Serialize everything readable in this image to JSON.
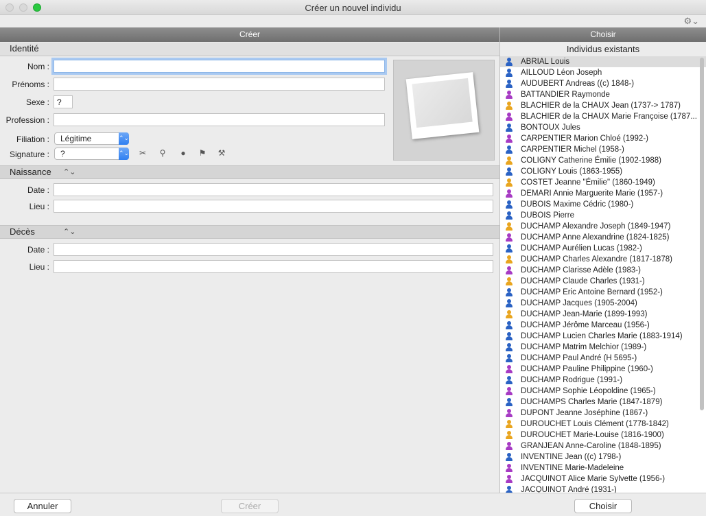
{
  "window": {
    "title": "Créer un nouvel individu"
  },
  "icons": {
    "settings": "gear-icon"
  },
  "headers": {
    "left": "Créer",
    "right": "Choisir"
  },
  "identity": {
    "title": "Identité",
    "nom_label": "Nom :",
    "nom_value": "",
    "prenoms_label": "Prénoms :",
    "prenoms_value": "",
    "sexe_label": "Sexe :",
    "sexe_value": "?",
    "profession_label": "Profession :",
    "profession_value": "",
    "filiation_label": "Filiation :",
    "filiation_value": "Légitime",
    "signature_label": "Signature :",
    "signature_value": "?",
    "signature_icons": [
      "scissors-icon",
      "search-cross-icon",
      "person-icon",
      "flag-icon",
      "gavel-icon"
    ]
  },
  "naissance": {
    "title": "Naissance",
    "date_label": "Date :",
    "date_value": "",
    "lieu_label": "Lieu :",
    "lieu_value": ""
  },
  "deces": {
    "title": "Décès",
    "date_label": "Date :",
    "date_value": "",
    "lieu_label": "Lieu :",
    "lieu_value": ""
  },
  "list": {
    "title": "Individus existants",
    "colors": {
      "male": "#2a62c4",
      "female": "#a73bc4",
      "unknown": "#e9a51f"
    },
    "items": [
      {
        "name": "ABRIAL Louis",
        "sex": "male",
        "selected": true
      },
      {
        "name": "AILLOUD Léon Joseph",
        "sex": "male"
      },
      {
        "name": "AUDUBERT Andreas ((c) 1848-)",
        "sex": "male"
      },
      {
        "name": "BATTANDIER Raymonde",
        "sex": "female"
      },
      {
        "name": "BLACHIER de la CHAUX Jean (1737-> 1787)",
        "sex": "unknown"
      },
      {
        "name": "BLACHIER de la CHAUX Marie Françoise (1787...",
        "sex": "female"
      },
      {
        "name": "BONTOUX Jules",
        "sex": "male"
      },
      {
        "name": "CARPENTIER Marion Chloé (1992-)",
        "sex": "female"
      },
      {
        "name": "CARPENTIER Michel (1958-)",
        "sex": "male"
      },
      {
        "name": "COLIGNY Catherine Émilie (1902-1988)",
        "sex": "unknown"
      },
      {
        "name": "COLIGNY Louis (1863-1955)",
        "sex": "male"
      },
      {
        "name": "COSTET Jeanne \"Émilie\" (1860-1949)",
        "sex": "unknown"
      },
      {
        "name": "DEMARI Annie Marguerite Marie (1957-)",
        "sex": "female"
      },
      {
        "name": "DUBOIS Maxime Cédric (1980-)",
        "sex": "male"
      },
      {
        "name": "DUBOIS Pierre",
        "sex": "male"
      },
      {
        "name": "DUCHAMP Alexandre Joseph (1849-1947)",
        "sex": "unknown"
      },
      {
        "name": "DUCHAMP Anne Alexandrine (1824-1825)",
        "sex": "female"
      },
      {
        "name": "DUCHAMP Aurélien Lucas (1982-)",
        "sex": "male"
      },
      {
        "name": "DUCHAMP Charles Alexandre (1817-1878)",
        "sex": "unknown"
      },
      {
        "name": "DUCHAMP Clarisse Adèle (1983-)",
        "sex": "female"
      },
      {
        "name": "DUCHAMP Claude Charles (1931-)",
        "sex": "unknown"
      },
      {
        "name": "DUCHAMP Eric Antoine Bernard (1952-)",
        "sex": "male"
      },
      {
        "name": "DUCHAMP Jacques (1905-2004)",
        "sex": "male"
      },
      {
        "name": "DUCHAMP Jean-Marie (1899-1993)",
        "sex": "unknown"
      },
      {
        "name": "DUCHAMP Jérôme Marceau (1956-)",
        "sex": "male"
      },
      {
        "name": "DUCHAMP Lucien Charles Marie (1883-1914)",
        "sex": "male"
      },
      {
        "name": "DUCHAMP Matrim Melchior (1989-)",
        "sex": "male"
      },
      {
        "name": "DUCHAMP Paul André (H 5695-)",
        "sex": "male"
      },
      {
        "name": "DUCHAMP Pauline Philippine (1960-)",
        "sex": "female"
      },
      {
        "name": "DUCHAMP Rodrigue (1991-)",
        "sex": "male"
      },
      {
        "name": "DUCHAMP Sophie Léopoldine (1965-)",
        "sex": "female"
      },
      {
        "name": "DUCHAMPS Charles Marie (1847-1879)",
        "sex": "male"
      },
      {
        "name": "DUPONT Jeanne Joséphine (1867-)",
        "sex": "female"
      },
      {
        "name": "DUROUCHET Louis Clément (1778-1842)",
        "sex": "unknown"
      },
      {
        "name": "DUROUCHET Marie-Louise (1816-1900)",
        "sex": "unknown"
      },
      {
        "name": "GRANJEAN Anne-Caroline (1848-1895)",
        "sex": "female"
      },
      {
        "name": "INVENTINE Jean ((c) 1798-)",
        "sex": "male"
      },
      {
        "name": "INVENTINE Marie-Madeleine",
        "sex": "female"
      },
      {
        "name": "JACQUINOT Alice Marie Sylvette (1956-)",
        "sex": "female"
      },
      {
        "name": "JACQUINOT André (1931-)",
        "sex": "male"
      }
    ]
  },
  "buttons": {
    "cancel": "Annuler",
    "create": "Créer",
    "choose": "Choisir"
  }
}
